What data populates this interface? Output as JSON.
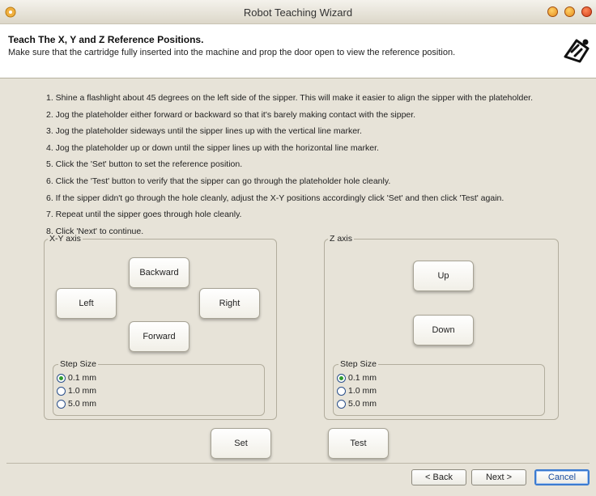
{
  "window": {
    "title": "Robot Teaching Wizard"
  },
  "header": {
    "title": "Teach The X, Y and Z Reference Positions.",
    "subtitle": "Make sure that the cartridge fully inserted into the machine and prop the door open to view the  reference position."
  },
  "instructions": [
    "1. Shine a flashlight about 45 degrees on the left side of the sipper.  This will make it easier to align the sipper with the plateholder.",
    "2. Jog the plateholder either forward or backward so that it's barely making contact with the sipper.",
    "3. Jog the plateholder sideways until the sipper lines up with the vertical line marker.",
    "4. Jog the plateholder up or down until the sipper lines up with the horizontal line marker.",
    "5. Click the 'Set' button to set the reference position.",
    "6. Click the 'Test' button to verify that the sipper can go through the plateholder hole cleanly.",
    "6. If the sipper didn't go through the hole cleanly, adjust the X-Y positions accordingly click 'Set' and then click 'Test' again.",
    "7. Repeat until the sipper goes through hole cleanly.",
    "8. Click 'Next' to continue."
  ],
  "xy_group": {
    "legend": "X-Y axis",
    "backward": "Backward",
    "left": "Left",
    "right": "Right",
    "forward": "Forward",
    "step_size": {
      "legend": "Step Size",
      "options": [
        "0.1 mm",
        "1.0 mm",
        "5.0 mm"
      ],
      "selected": "0.1 mm"
    }
  },
  "z_group": {
    "legend": "Z axis",
    "up": "Up",
    "down": "Down",
    "step_size": {
      "legend": "Step Size",
      "options": [
        "0.1 mm",
        "1.0 mm",
        "5.0 mm"
      ],
      "selected": "0.1 mm"
    }
  },
  "actions": {
    "set": "Set",
    "test": "Test"
  },
  "nav": {
    "back": "< Back",
    "next": "Next >",
    "cancel": "Cancel"
  },
  "colors": {
    "accent": "#3b7bd0",
    "radio_dot": "#2f9a2f",
    "window_close": "#d2401c"
  }
}
